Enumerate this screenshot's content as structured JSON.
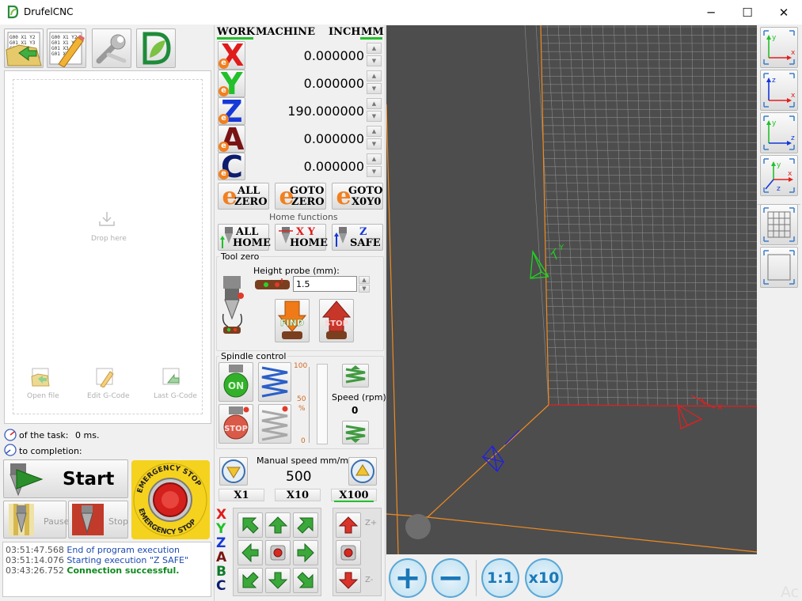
{
  "app": {
    "title": "DrufelCNC"
  },
  "window_controls": {
    "minimize": "─",
    "maximize": "☐",
    "close": "✕"
  },
  "toolbar": {
    "items": [
      {
        "name": "open-file",
        "icon": "open-folder-gcode-icon"
      },
      {
        "name": "edit-gcode",
        "icon": "pencil-gcode-icon"
      },
      {
        "name": "settings",
        "icon": "wrench-icon"
      },
      {
        "name": "about",
        "icon": "drufel-logo-icon"
      }
    ],
    "gcode_snippets": [
      "G00 X1 Y2",
      "G01 X1 Y3",
      "G01 X3",
      "G01 X1"
    ]
  },
  "drop_area": {
    "drop_here": "Drop here",
    "open_file": "Open file",
    "edit_gcode": "Edit G-Code",
    "last_gcode": "Last G-Code"
  },
  "task_status": {
    "elapsed_label": "of the task:",
    "elapsed_value": "0 ms.",
    "remaining_label": "to completion:"
  },
  "controls": {
    "start": "Start",
    "pause": "Pause",
    "stop": "Stop",
    "estop_top": "EMERGENCY STOP",
    "estop_bottom": "EMERGENCY STOP"
  },
  "log": [
    {
      "time": "03:51:47.568",
      "text": "End of program execution",
      "bold": false
    },
    {
      "time": "03:51:14.076",
      "text": "Starting execution \"Z SAFE\"",
      "bold": false
    },
    {
      "time": "03:43:26.752",
      "text": "Connection successful.",
      "bold": true
    }
  ],
  "coords": {
    "tabs": {
      "work": "WORK",
      "machine": "MACHINE",
      "active": "work"
    },
    "units": {
      "inch": "INCH",
      "mm": "MM",
      "active": "mm"
    },
    "axes": [
      {
        "letter": "X",
        "value": "0.000000",
        "color": "#e01b1b"
      },
      {
        "letter": "Y",
        "value": "0.000000",
        "color": "#22c02a"
      },
      {
        "letter": "Z",
        "value": "190.000000",
        "color": "#1538d8"
      },
      {
        "letter": "A",
        "value": "0.000000",
        "color": "#7a1414"
      },
      {
        "letter": "C",
        "value": "0.000000",
        "color": "#0c1c6e"
      }
    ]
  },
  "zero_buttons": {
    "all_zero": [
      "ALL",
      "ZERO"
    ],
    "goto_zero": [
      "GOTO",
      "ZERO"
    ],
    "goto_x0y0": [
      "GOTO",
      "X0Y0"
    ]
  },
  "home": {
    "label": "Home functions",
    "all_home": [
      "ALL",
      "HOME"
    ],
    "xy_home": [
      "X Y",
      "HOME"
    ],
    "z_safe": [
      "Z",
      "SAFE"
    ]
  },
  "tool_zero": {
    "label": "Tool zero",
    "height_label": "Height probe (mm):",
    "height_value": "1.5",
    "find": "FIND",
    "stop": "STOP"
  },
  "spindle": {
    "label": "Spindle control",
    "on": "ON",
    "stop": "STOP",
    "scale": [
      "100",
      "50",
      "%",
      "0"
    ],
    "speed_label": "Speed (rpm)",
    "speed_value": "0"
  },
  "manual": {
    "label": "Manual speed mm/min",
    "value": "500",
    "multipliers": [
      "X1",
      "X10",
      "X100"
    ],
    "active_multiplier": "X100"
  },
  "jog": {
    "axis_letters": [
      {
        "letter": "X",
        "color": "#e01b1b"
      },
      {
        "letter": "Y",
        "color": "#22c02a"
      },
      {
        "letter": "Z",
        "color": "#1538d8"
      },
      {
        "letter": "A",
        "color": "#7a1414"
      },
      {
        "letter": "B",
        "color": "#0f7a2a"
      },
      {
        "letter": "C",
        "color": "#0c1c6e"
      }
    ],
    "z_plus": "Z+",
    "z_minus": "Z-"
  },
  "viewport": {
    "background": "#4d4d4d",
    "grid_color": "#8a8a8a",
    "axis_labels": {
      "y": "Y",
      "x": "X"
    }
  },
  "view_buttons": [
    {
      "name": "view-top",
      "axes": [
        "y",
        "x"
      ]
    },
    {
      "name": "view-front",
      "axes": [
        "z",
        "x"
      ]
    },
    {
      "name": "view-side",
      "axes": [
        "y",
        "z"
      ]
    },
    {
      "name": "view-iso",
      "axes": [
        "y",
        "x",
        "z"
      ]
    }
  ],
  "zoom": {
    "zoom_in": "+",
    "zoom_out": "−",
    "one_to_one": "1:1",
    "times_ten": "x10"
  },
  "watermark": "Ac"
}
